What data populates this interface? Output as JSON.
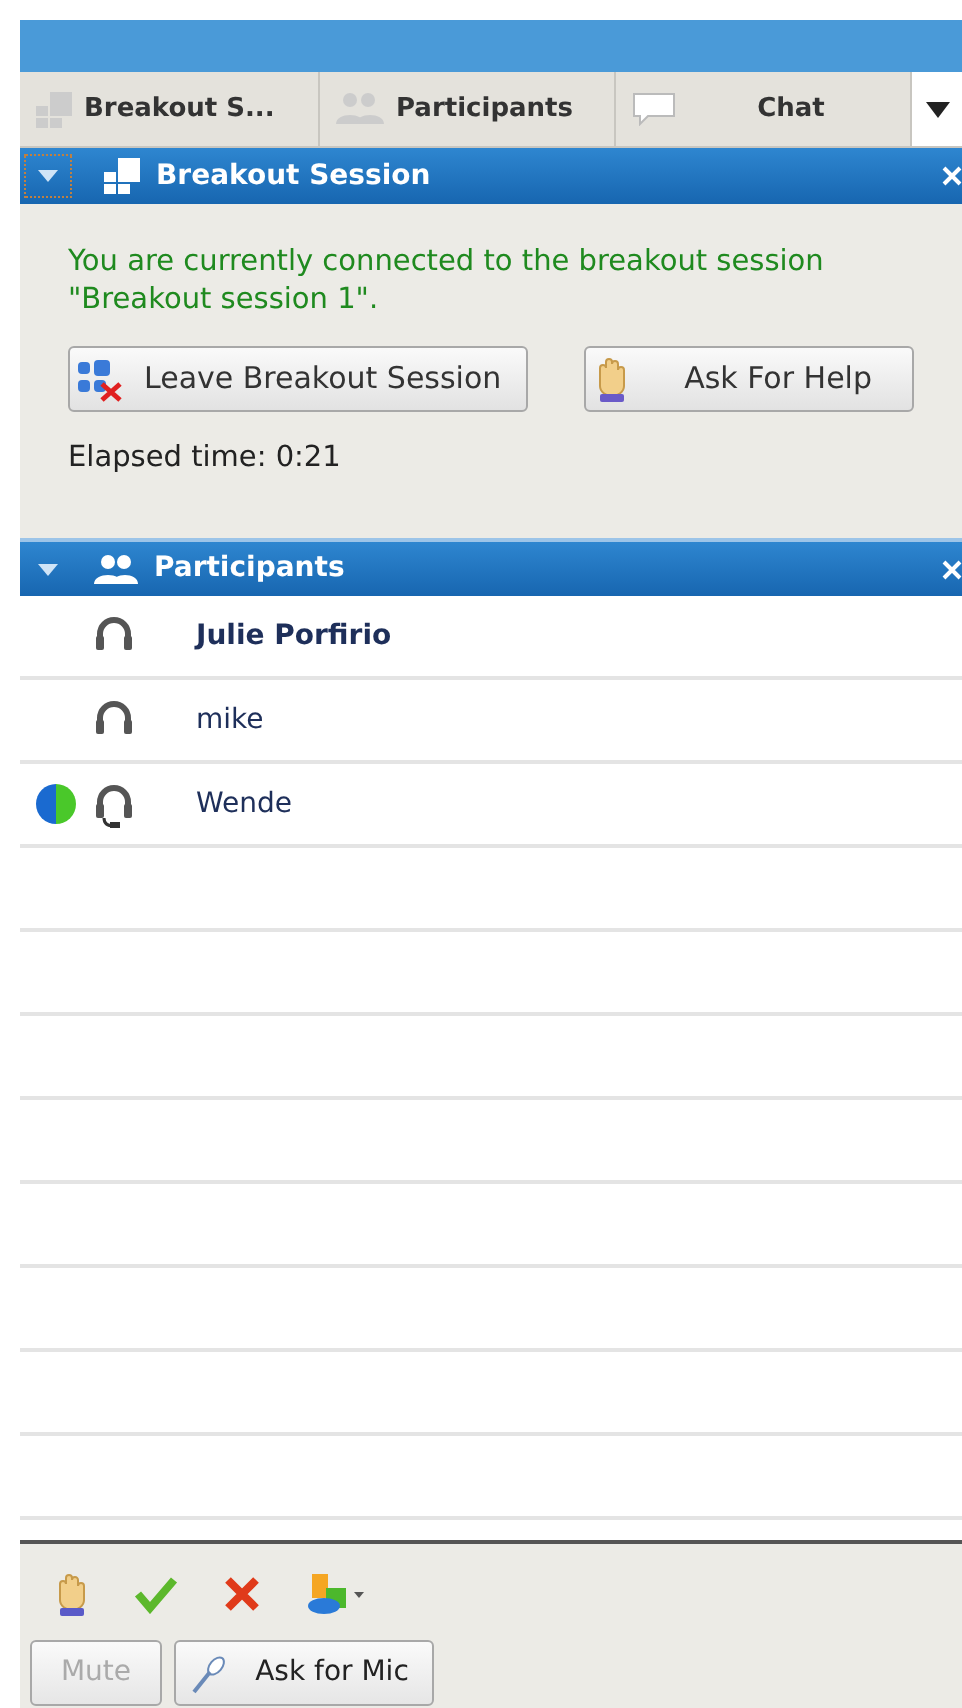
{
  "tabs": [
    {
      "label": "Breakout S..."
    },
    {
      "label": "Participants"
    },
    {
      "label": "Chat"
    }
  ],
  "breakout_panel": {
    "title": "Breakout Session",
    "message": "You are currently connected to the breakout session \"Breakout session 1\".",
    "buttons": [
      {
        "label": "Leave Breakout Session"
      },
      {
        "label": "Ask For Help"
      }
    ],
    "elapsed": "Elapsed time: 0:21"
  },
  "participants_panel": {
    "title": "Participants",
    "rows": [
      {
        "name": "Julie Porfirio",
        "bold": true,
        "presenter": false,
        "mic": false
      },
      {
        "name": "mike",
        "bold": false,
        "presenter": false,
        "mic": false
      },
      {
        "name": "Wende",
        "bold": false,
        "presenter": true,
        "mic": true
      }
    ]
  },
  "toolbar": {
    "buttons": [
      {
        "label": "Mute",
        "disabled": true
      },
      {
        "label": "Ask for Mic",
        "disabled": false
      }
    ]
  }
}
